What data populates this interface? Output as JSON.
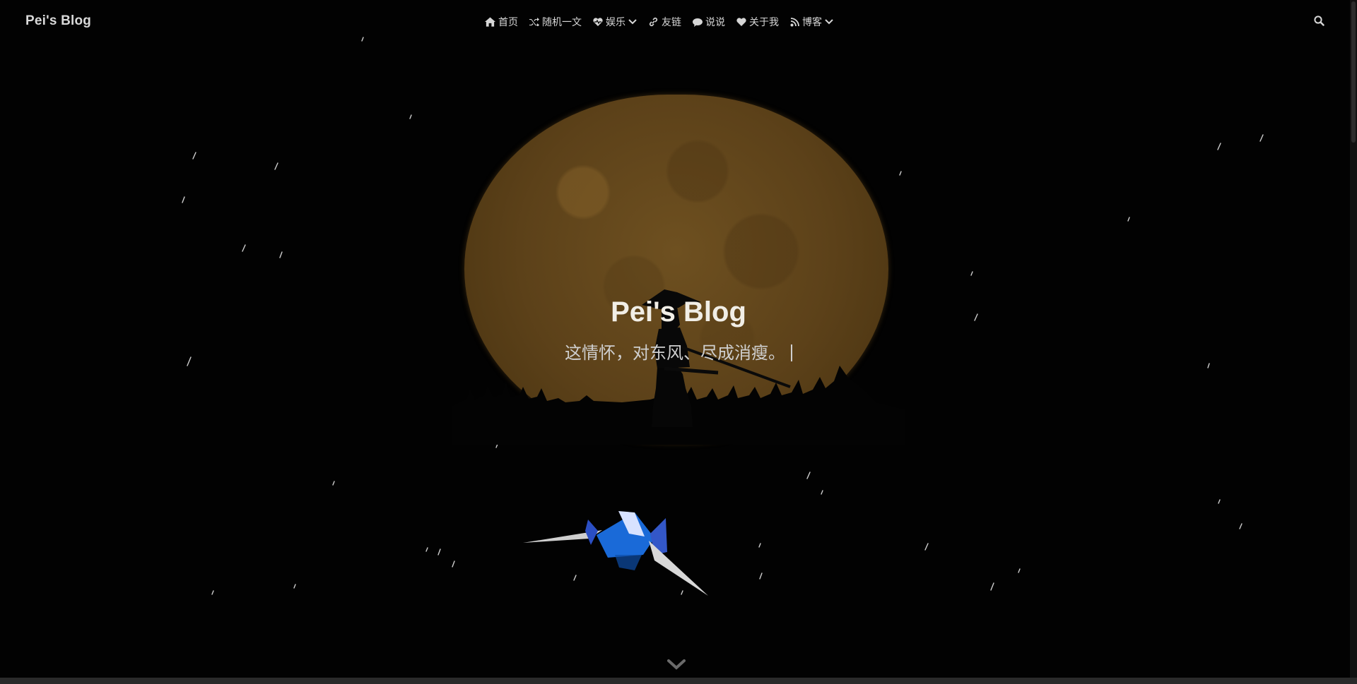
{
  "site": {
    "brand": "Pei's Blog"
  },
  "nav": {
    "items": [
      {
        "label": "首页",
        "icon": "home-icon",
        "dropdown": false
      },
      {
        "label": "随机一文",
        "icon": "shuffle-icon",
        "dropdown": false
      },
      {
        "label": "娱乐",
        "icon": "heartbeat-icon",
        "dropdown": true
      },
      {
        "label": "友链",
        "icon": "link-icon",
        "dropdown": false
      },
      {
        "label": "说说",
        "icon": "comment-icon",
        "dropdown": false
      },
      {
        "label": "关于我",
        "icon": "heart-icon",
        "dropdown": false
      },
      {
        "label": "博客",
        "icon": "blog-icon",
        "dropdown": true
      }
    ],
    "search_icon": "search-icon"
  },
  "hero": {
    "title": "Pei's Blog",
    "subtitle": "这情怀，对东风、尽成消瘦。"
  },
  "colors": {
    "background": "#020202",
    "moon": "#5c4119",
    "text": "#d6d6d6",
    "bird_blue": "#1e6fe0"
  }
}
